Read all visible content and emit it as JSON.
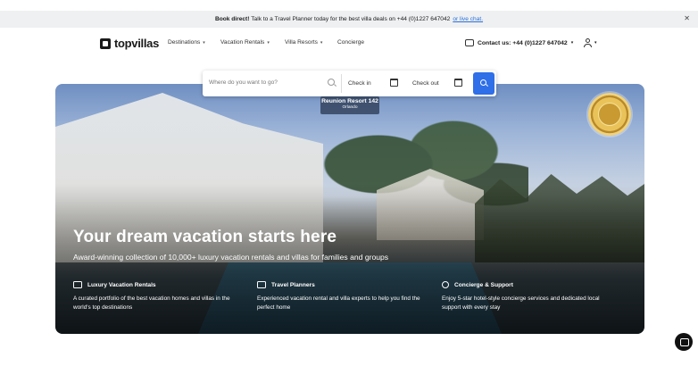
{
  "banner": {
    "bold": "Book direct!",
    "text": "Talk to a Travel Planner today for the best villa deals on +44 (0)1227 647042",
    "link": "or live chat."
  },
  "brand": {
    "name": "topvillas"
  },
  "nav": {
    "destinations": "Destinations",
    "vacation_rentals": "Vacation Rentals",
    "villa_resorts": "Villa Resorts",
    "concierge": "Concierge",
    "contact": "Contact us: +44 (0)1227 647042"
  },
  "search": {
    "destination_placeholder": "Where do you want to go?",
    "check_in": "Check in",
    "check_out": "Check out"
  },
  "photo_tag": {
    "title": "Reunion Resort 142",
    "location": "Orlando"
  },
  "hero": {
    "title": "Your dream vacation starts here",
    "subtitle": "Award-winning collection of 10,000+ luxury vacation rentals and villas for families and groups"
  },
  "features": [
    {
      "title": "Luxury Vacation Rentals",
      "text": "A curated portfolio of the best vacation homes and villas in the world's top destinations",
      "icon": "sofa-icon"
    },
    {
      "title": "Travel Planners",
      "text": "Experienced vacation rental and villa experts to help you find the perfect home",
      "icon": "plane-map-icon"
    },
    {
      "title": "Concierge & Support",
      "text": "Enjoy 5-star hotel-style concierge services and dedicated local support with every stay",
      "icon": "check-circle-icon"
    }
  ],
  "colors": {
    "accent": "#2f6fe8",
    "banner_bg": "#eef0f2"
  }
}
